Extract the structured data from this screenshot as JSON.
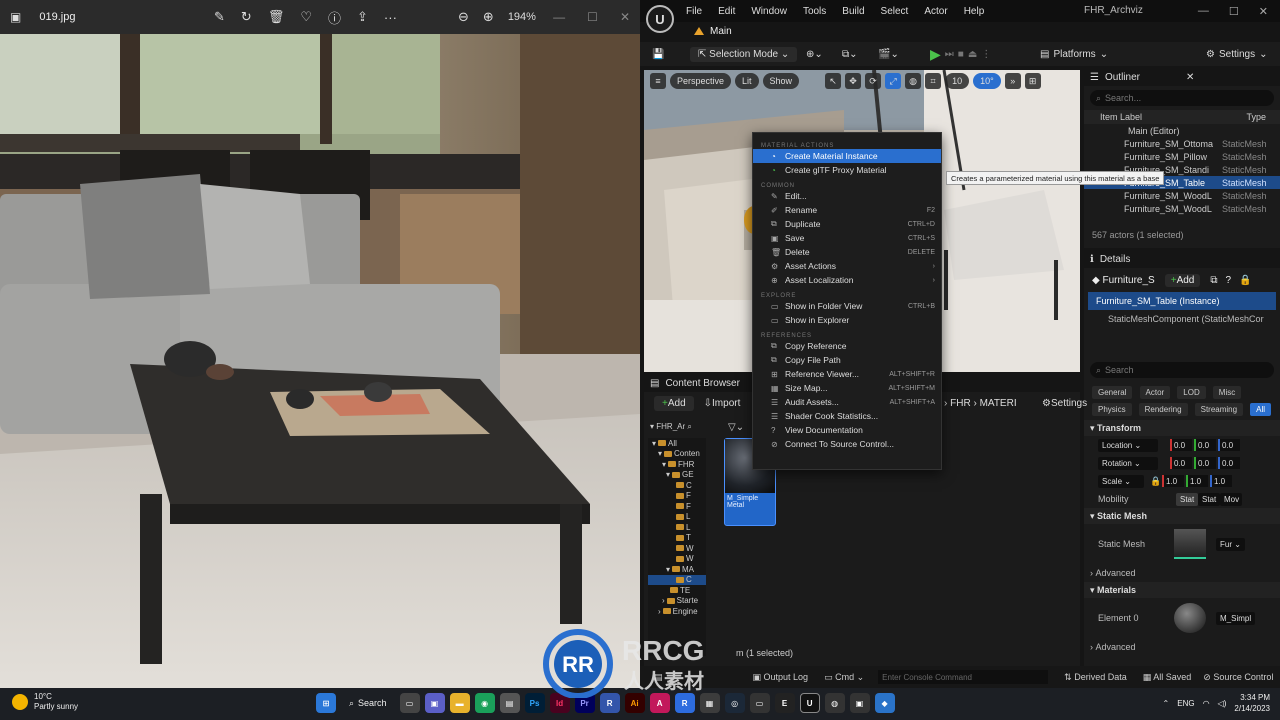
{
  "photo_viewer": {
    "filename": "019.jpg",
    "zoom": "194%"
  },
  "ue": {
    "menu": [
      "File",
      "Edit",
      "Window",
      "Tools",
      "Build",
      "Select",
      "Actor",
      "Help"
    ],
    "project": "FHR_Archviz",
    "tab": "Main",
    "toolbar": {
      "selection_mode": "Selection Mode",
      "platforms": "Platforms",
      "settings": "Settings"
    },
    "viewport": {
      "perspective": "Perspective",
      "lit": "Lit",
      "show": "Show",
      "grid": "10",
      "angle": "10°"
    },
    "outliner": {
      "title": "Outliner",
      "search": "Search...",
      "col_label": "Item Label",
      "col_type": "Type",
      "root": "Main (Editor)",
      "rows": [
        {
          "label": "Furniture_SM_Ottoma",
          "type": "StaticMesh"
        },
        {
          "label": "Furniture_SM_Pillow",
          "type": "StaticMesh"
        },
        {
          "label": "Furniture_SM_Standi",
          "type": "StaticMesh"
        },
        {
          "label": "Furniture_SM_Table",
          "type": "StaticMesh"
        },
        {
          "label": "Furniture_SM_WoodL",
          "type": "StaticMesh"
        },
        {
          "label": "Furniture_SM_WoodL",
          "type": "StaticMesh"
        }
      ],
      "count": "567 actors (1 selected)"
    },
    "details": {
      "title": "Details",
      "name": "Furniture_S",
      "add": "Add",
      "instance": "Furniture_SM_Table (Instance)",
      "component": "StaticMeshComponent (StaticMeshCor",
      "search": "Search",
      "filters": [
        "General",
        "Actor",
        "LOD",
        "Misc",
        "Physics",
        "Rendering",
        "Streaming",
        "All"
      ],
      "transform": "Transform",
      "location": "Location",
      "rotation": "Rotation",
      "scale": "Scale",
      "loc_vals": [
        "0.0",
        "0.0",
        "0.0"
      ],
      "rot_vals": [
        "0.0",
        "0.0",
        "0.0"
      ],
      "scale_vals": [
        "1.0",
        "1.0",
        "1.0"
      ],
      "mobility": "Mobility",
      "mobility_opts": [
        "Stat",
        "Stat",
        "Mov"
      ],
      "static_mesh_section": "Static Mesh",
      "static_mesh_label": "Static Mesh",
      "static_mesh_val": "Fur",
      "advanced": "Advanced",
      "materials": "Materials",
      "element0": "Element 0",
      "element0_val": "M_Simpl",
      "advanced2": "Advanced"
    },
    "content_browser": {
      "title": "Content Browser",
      "add": "Add",
      "import": "Import",
      "path": [
        "FHR",
        "MATERI"
      ],
      "settings": "Settings",
      "tree_root": "FHR_Ar",
      "tree": [
        "All",
        "Conten",
        "FHR",
        "GE",
        "C",
        "F",
        "F",
        "L",
        "L",
        "T",
        "W",
        "W",
        "MA",
        "C",
        "TE",
        "Starte",
        "Engine"
      ],
      "asset_name": "M_Simple Metal",
      "selection": "m (1 selected)"
    },
    "status": {
      "output_log": "Output Log",
      "cmd": "Cmd",
      "console": "Enter Console Command",
      "derived": "Derived Data",
      "saved": "All Saved",
      "source": "Source Control"
    }
  },
  "context_menu": {
    "sections": {
      "material": "MATERIAL ACTIONS",
      "common": "COMMON",
      "explore": "EXPLORE",
      "references": "REFERENCES"
    },
    "material_items": [
      {
        "label": "Create Material Instance",
        "shortcut": ""
      },
      {
        "label": "Create glTF Proxy Material",
        "shortcut": ""
      }
    ],
    "common_items": [
      {
        "label": "Edit...",
        "shortcut": ""
      },
      {
        "label": "Rename",
        "shortcut": "F2"
      },
      {
        "label": "Duplicate",
        "shortcut": "CTRL+D"
      },
      {
        "label": "Save",
        "shortcut": "CTRL+S"
      },
      {
        "label": "Delete",
        "shortcut": "DELETE"
      },
      {
        "label": "Asset Actions",
        "shortcut": "›"
      },
      {
        "label": "Asset Localization",
        "shortcut": "›"
      }
    ],
    "explore_items": [
      {
        "label": "Show in Folder View",
        "shortcut": "CTRL+B"
      },
      {
        "label": "Show in Explorer",
        "shortcut": ""
      }
    ],
    "reference_items": [
      {
        "label": "Copy Reference",
        "shortcut": ""
      },
      {
        "label": "Copy File Path",
        "shortcut": ""
      },
      {
        "label": "Reference Viewer...",
        "shortcut": "ALT+SHIFT+R"
      },
      {
        "label": "Size Map...",
        "shortcut": "ALT+SHIFT+M"
      },
      {
        "label": "Audit Assets...",
        "shortcut": "ALT+SHIFT+A"
      },
      {
        "label": "Shader Cook Statistics...",
        "shortcut": ""
      },
      {
        "label": "View Documentation",
        "shortcut": ""
      },
      {
        "label": "Connect To Source Control...",
        "shortcut": ""
      }
    ],
    "tooltip": "Creates a parameterized material using this material as a base"
  },
  "taskbar": {
    "temp": "10°C",
    "weather": "Partly sunny",
    "search": "Search",
    "lang": "ENG",
    "time": "3:34 PM",
    "date": "2/14/2023"
  },
  "watermark": {
    "brand": "RRCG",
    "sub": "人人素材"
  }
}
